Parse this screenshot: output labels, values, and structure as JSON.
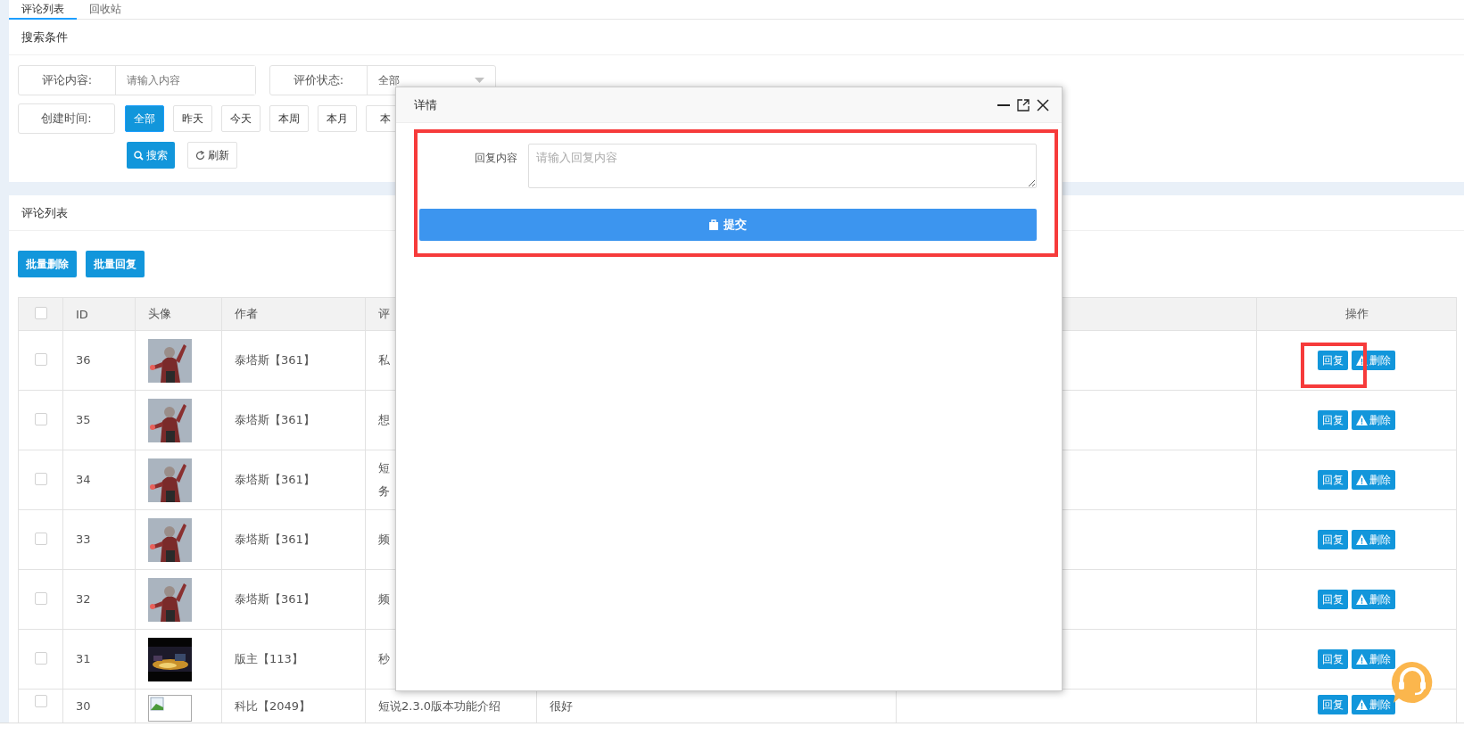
{
  "tabs": [
    {
      "label": "评论列表",
      "selected": true
    },
    {
      "label": "回收站",
      "selected": false
    }
  ],
  "search": {
    "title": "搜索条件",
    "content_field": {
      "label": "评论内容:",
      "placeholder": "请输入内容"
    },
    "status_select": {
      "label": "评价状态:",
      "value": "全部"
    },
    "time_label": "创建时间:",
    "time_options": [
      {
        "label": "全部",
        "selected": true
      },
      {
        "label": "昨天",
        "selected": false
      },
      {
        "label": "今天",
        "selected": false
      },
      {
        "label": "本周",
        "selected": false
      },
      {
        "label": "本月",
        "selected": false
      },
      {
        "label": "本",
        "selected": false
      }
    ],
    "search_button": "搜索",
    "refresh_button": "刷新"
  },
  "list": {
    "title": "评论列表",
    "batch_buttons": [
      "批量删除",
      "批量回复"
    ],
    "select_all_checked": false,
    "columns": [
      "ID",
      "头像",
      "作者",
      "评",
      "操作"
    ],
    "rows": [
      {
        "checked": false,
        "id": "36",
        "avatar": {
          "kind": "picture"
        },
        "author": "泰塔斯【361】",
        "column_5": [
          "私"
        ],
        "actions": [
          "回复",
          "删除"
        ]
      },
      {
        "checked": false,
        "id": "35",
        "avatar": {
          "kind": "picture"
        },
        "author": "泰塔斯【361】",
        "column_5": [
          "想"
        ],
        "actions": [
          "回复",
          "删除"
        ]
      },
      {
        "checked": false,
        "id": "34",
        "avatar": {
          "kind": "picture"
        },
        "author": "泰塔斯【361】",
        "column_5": [
          "短",
          "务"
        ],
        "actions": [
          "回复",
          "删除"
        ]
      },
      {
        "checked": false,
        "id": "33",
        "avatar": {
          "kind": "picture"
        },
        "author": "泰塔斯【361】",
        "column_5": [
          "频"
        ],
        "actions": [
          "回复",
          "删除"
        ]
      },
      {
        "checked": false,
        "id": "32",
        "avatar": {
          "kind": "picture"
        },
        "author": "泰塔斯【361】",
        "column_5": [
          "频"
        ],
        "actions": [
          "回复",
          "删除"
        ]
      },
      {
        "checked": false,
        "id": "31",
        "avatar": {
          "kind": "picture"
        },
        "author": "版主【113】",
        "column_5": [
          "秒"
        ],
        "actions": [
          "回复",
          "删除"
        ]
      },
      {
        "checked": false,
        "id": "30",
        "avatar": {
          "kind": "broken"
        },
        "author": "科比【2049】",
        "column_5": [
          "短说2.3.0版本功能介绍"
        ],
        "column_6": "很好",
        "actions": [
          "回复",
          "删除"
        ]
      }
    ]
  },
  "dialog": {
    "title": "详情",
    "label": "回复内容",
    "placeholder": "请输入回复内容",
    "submit": "提交"
  }
}
